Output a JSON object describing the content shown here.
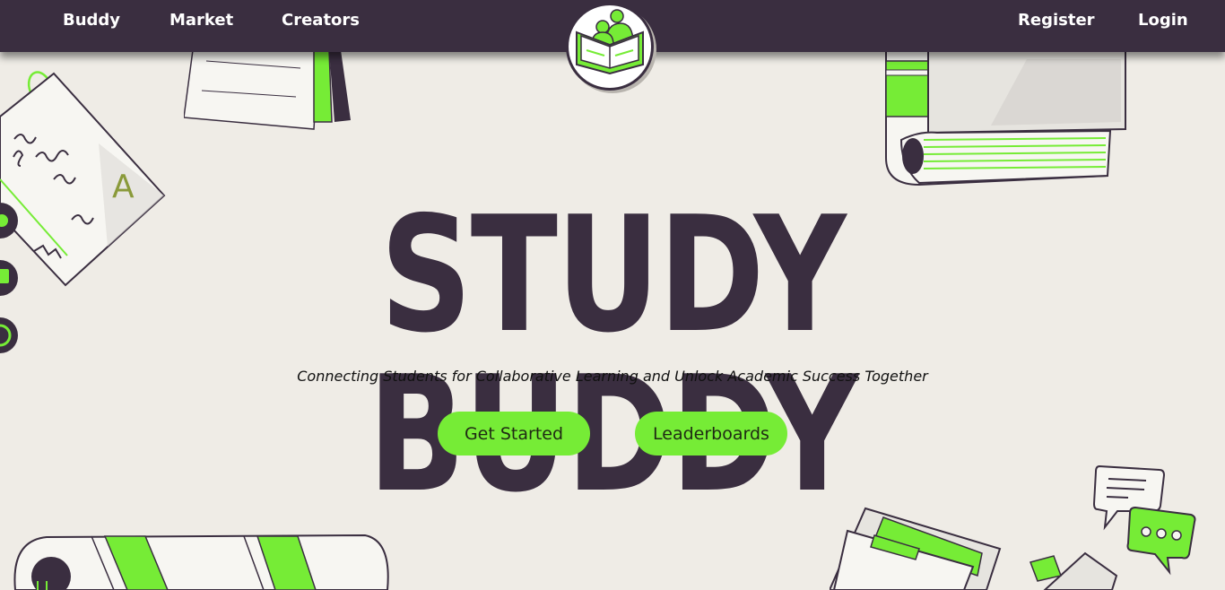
{
  "nav": {
    "links_left": [
      "Buddy",
      "Market",
      "Creators"
    ],
    "links_right": [
      "Register",
      "Login"
    ]
  },
  "hero": {
    "title": "STUDY BUDDY",
    "tagline": "Connecting Students for Collaborative Learning and Unlock Academic Success Together"
  },
  "buttons": {
    "get_started": "Get Started",
    "leaderboards": "Leaderboards"
  },
  "colors": {
    "nav_bg": "#3a2e40",
    "accent": "#76ec36",
    "page_bg": "#efece6",
    "title": "#3a2e40"
  },
  "icons": [
    "book-people-logo-icon",
    "notebook-icon",
    "book-icon",
    "chat-bubbles-icon",
    "folder-icon"
  ]
}
